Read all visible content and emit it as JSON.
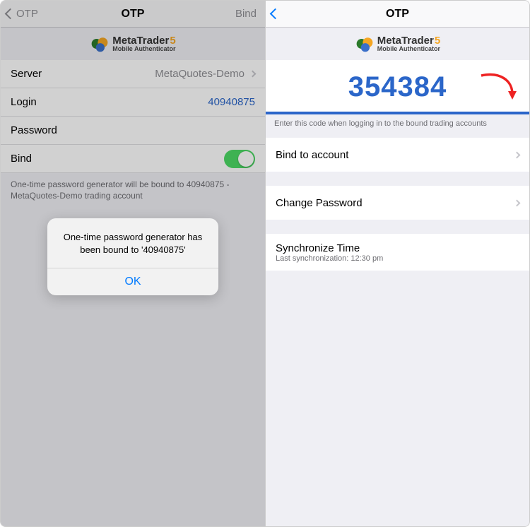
{
  "left": {
    "nav": {
      "back_label": "OTP",
      "title": "OTP",
      "right_label": "Bind"
    },
    "brand": {
      "name": "MetaTrader",
      "version_digit": "5",
      "subtitle": "Mobile Authenticator"
    },
    "rows": {
      "server": {
        "label": "Server",
        "value": "MetaQuotes-Demo"
      },
      "login": {
        "label": "Login",
        "value": "40940875"
      },
      "password": {
        "label": "Password"
      },
      "bind": {
        "label": "Bind",
        "on": true
      }
    },
    "footer": "One-time password generator will be bound to 40940875 - MetaQuotes-Demo trading account",
    "alert": {
      "message": "One-time password generator has been bound to '40940875'",
      "ok_label": "OK"
    }
  },
  "right": {
    "nav": {
      "title": "OTP"
    },
    "brand": {
      "name": "MetaTrader",
      "version_digit": "5",
      "subtitle": "Mobile Authenticator"
    },
    "otp": {
      "code": "354384",
      "hint": "Enter this code when logging in to the bound trading accounts"
    },
    "menu": {
      "bind": "Bind to account",
      "change_password": "Change Password",
      "sync_time": "Synchronize Time",
      "sync_sub": "Last synchronization: 12:30 pm"
    }
  }
}
